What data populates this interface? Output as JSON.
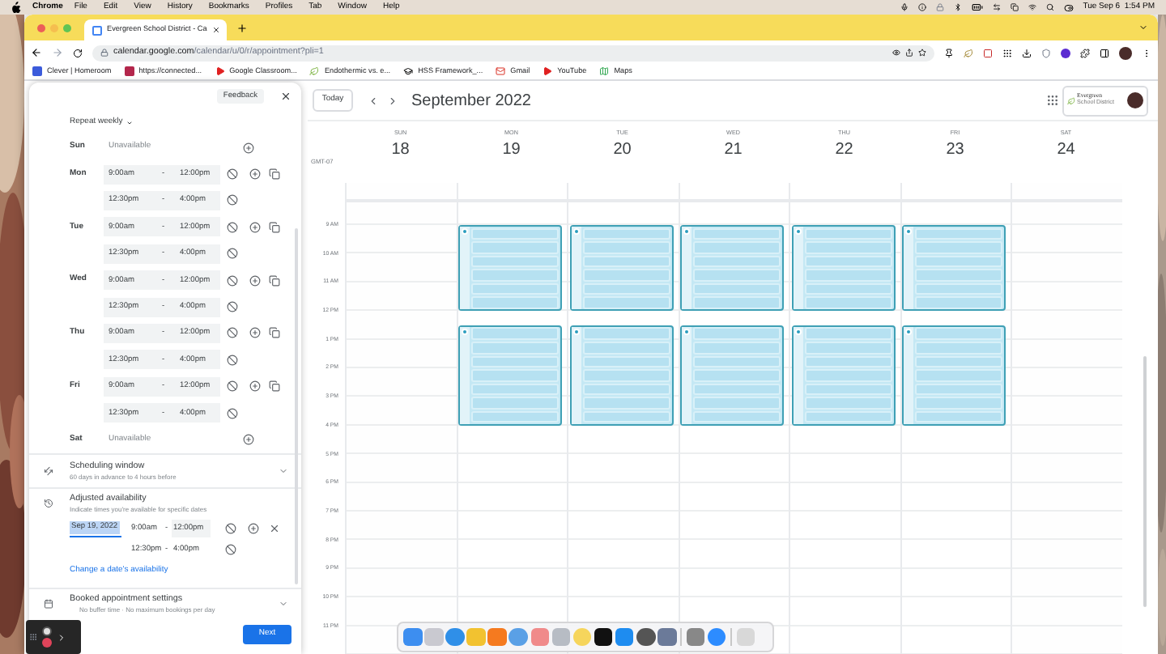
{
  "menu_bar": {
    "app": "Chrome",
    "menus": [
      "File",
      "Edit",
      "View",
      "History",
      "Bookmarks",
      "Profiles",
      "Tab",
      "Window",
      "Help"
    ],
    "clock": "Tue Sep 6  1:54 PM"
  },
  "browser": {
    "tabs": [
      {
        "title": "Evergreen School District - Ca",
        "selected": true
      }
    ],
    "url_host": "calendar.google.com",
    "url_path": "/calendar/u/0/r/appointment?pli=1",
    "bookmarks": [
      {
        "label": "Clever | Homeroom",
        "kind": "clever"
      },
      {
        "label": "https://connected...",
        "kind": "m"
      },
      {
        "label": "Google Classroom...",
        "kind": "video"
      },
      {
        "label": "Endothermic vs. e...",
        "kind": "leaf"
      },
      {
        "label": "HSS Framework_...",
        "kind": "cap"
      },
      {
        "label": "Gmail",
        "kind": "mail"
      },
      {
        "label": "YouTube",
        "kind": "video"
      },
      {
        "label": "Maps",
        "kind": "map"
      }
    ]
  },
  "panel": {
    "feedback": "Feedback",
    "repeat": "Repeat weekly",
    "weekly": [
      {
        "day": "Sun",
        "kind": "unavailable",
        "text": "Unavailable"
      },
      {
        "day": "Mon",
        "kind": "hours",
        "ranges": [
          {
            "start": "9:00am",
            "dash": "-",
            "end": "12:00pm"
          },
          {
            "start": "12:30pm",
            "dash": "-",
            "end": "4:00pm"
          }
        ]
      },
      {
        "day": "Tue",
        "kind": "hours",
        "ranges": [
          {
            "start": "9:00am",
            "dash": "-",
            "end": "12:00pm"
          },
          {
            "start": "12:30pm",
            "dash": "-",
            "end": "4:00pm"
          }
        ]
      },
      {
        "day": "Wed",
        "kind": "hours",
        "ranges": [
          {
            "start": "9:00am",
            "dash": "-",
            "end": "12:00pm"
          },
          {
            "start": "12:30pm",
            "dash": "-",
            "end": "4:00pm"
          }
        ]
      },
      {
        "day": "Thu",
        "kind": "hours",
        "ranges": [
          {
            "start": "9:00am",
            "dash": "-",
            "end": "12:00pm"
          },
          {
            "start": "12:30pm",
            "dash": "-",
            "end": "4:00pm"
          }
        ]
      },
      {
        "day": "Fri",
        "kind": "hours",
        "ranges": [
          {
            "start": "9:00am",
            "dash": "-",
            "end": "12:00pm"
          },
          {
            "start": "12:30pm",
            "dash": "-",
            "end": "4:00pm"
          }
        ]
      },
      {
        "day": "Sat",
        "kind": "unavailable",
        "text": "Unavailable"
      }
    ],
    "scheduling_window": {
      "title": "Scheduling window",
      "subtitle": "60 days in advance to 4 hours before"
    },
    "adjusted_availability": {
      "title": "Adjusted availability",
      "subtitle": "Indicate times you're available for specific dates",
      "date": "Sep 19, 2022",
      "ranges": [
        {
          "start": "9:00am",
          "dash": "-",
          "end": "12:00pm"
        },
        {
          "start": "12:30pm",
          "dash": "-",
          "end": "4:00pm"
        }
      ],
      "link": "Change a date's availability"
    },
    "booked_settings": {
      "title": "Booked appointment settings",
      "subtitle": "No buffer time · No maximum bookings per day"
    },
    "next": "Next"
  },
  "calendar": {
    "today": "Today",
    "title": "September 2022",
    "logo_title": "Evergreen",
    "logo_subtitle": "School District",
    "timezone": "GMT-07",
    "days": [
      {
        "weekday": "SUN",
        "date": "18",
        "available": false
      },
      {
        "weekday": "MON",
        "date": "19",
        "available": true
      },
      {
        "weekday": "TUE",
        "date": "20",
        "available": true
      },
      {
        "weekday": "WED",
        "date": "21",
        "available": true
      },
      {
        "weekday": "THU",
        "date": "22",
        "available": true
      },
      {
        "weekday": "FRI",
        "date": "23",
        "available": true
      },
      {
        "weekday": "SAT",
        "date": "24",
        "available": false
      }
    ],
    "hours": [
      "9 AM",
      "10 AM",
      "11 AM",
      "12 PM",
      "1 PM",
      "2 PM",
      "3 PM",
      "4 PM",
      "5 PM",
      "6 PM",
      "7 PM",
      "8 PM",
      "9 PM",
      "10 PM",
      "11 PM"
    ]
  }
}
